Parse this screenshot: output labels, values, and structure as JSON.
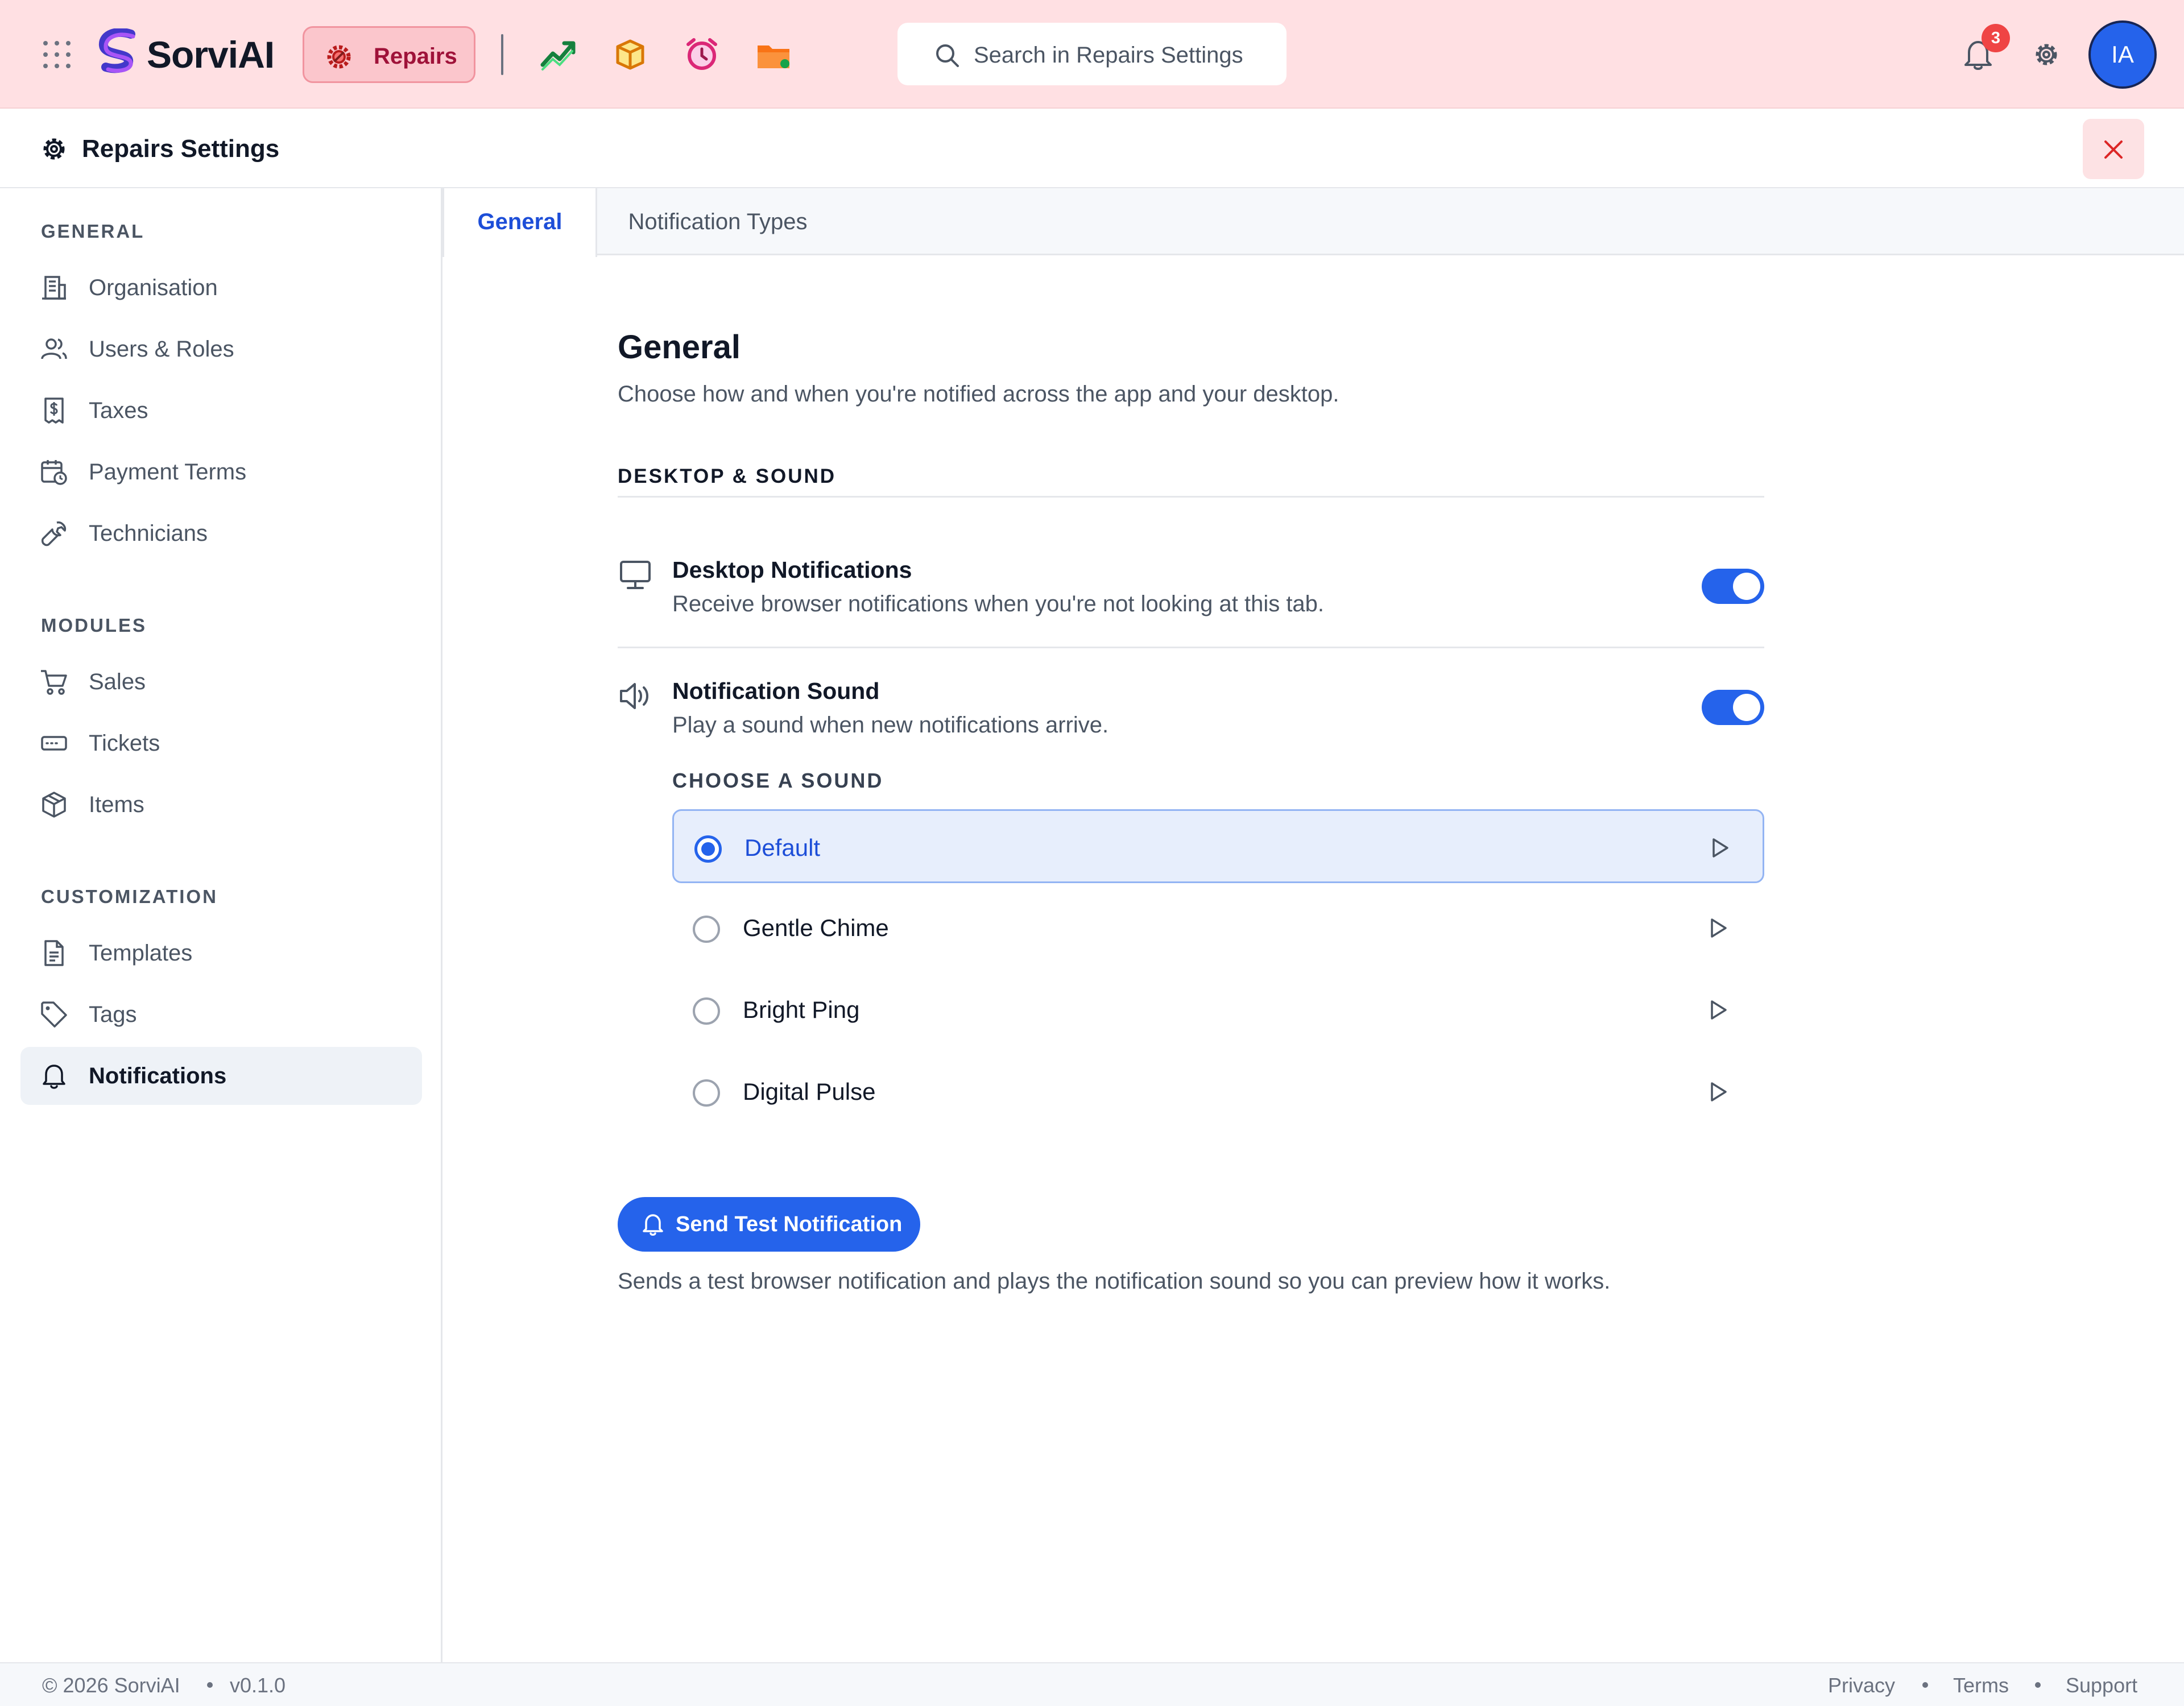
{
  "topbar": {
    "brand": "SorviAI",
    "module_label": "Repairs",
    "search_placeholder": "Search in Repairs Settings",
    "notification_count": "3",
    "avatar_initials": "IA",
    "app_icons": [
      "growth-chart-icon",
      "box-icon",
      "alarm-clock-icon",
      "folder-icon"
    ]
  },
  "settings": {
    "title": "Repairs Settings"
  },
  "sidebar": {
    "sections": [
      {
        "title": "GENERAL",
        "items": [
          {
            "label": "Organisation",
            "icon": "building-icon"
          },
          {
            "label": "Users & Roles",
            "icon": "users-icon"
          },
          {
            "label": "Taxes",
            "icon": "tax-icon"
          },
          {
            "label": "Payment Terms",
            "icon": "calendar-clock-icon"
          },
          {
            "label": "Technicians",
            "icon": "wrench-icon"
          }
        ]
      },
      {
        "title": "MODULES",
        "items": [
          {
            "label": "Sales",
            "icon": "cart-icon"
          },
          {
            "label": "Tickets",
            "icon": "ticket-icon"
          },
          {
            "label": "Items",
            "icon": "package-icon"
          }
        ]
      },
      {
        "title": "CUSTOMIZATION",
        "items": [
          {
            "label": "Templates",
            "icon": "document-icon"
          },
          {
            "label": "Tags",
            "icon": "tag-icon"
          },
          {
            "label": "Notifications",
            "icon": "bell-icon",
            "active": true
          }
        ]
      }
    ]
  },
  "tabs": [
    {
      "label": "General",
      "active": true
    },
    {
      "label": "Notification Types",
      "active": false
    }
  ],
  "main": {
    "title": "General",
    "subtitle": "Choose how and when you're notified across the app and your desktop.",
    "section_title": "DESKTOP & SOUND",
    "desktop": {
      "title": "Desktop Notifications",
      "description": "Receive browser notifications when you're not looking at this tab.",
      "enabled": true
    },
    "sound": {
      "title": "Notification Sound",
      "description": "Play a sound when new notifications arrive.",
      "enabled": true,
      "choose_label": "CHOOSE A SOUND",
      "options": [
        {
          "label": "Default",
          "selected": true
        },
        {
          "label": "Gentle Chime",
          "selected": false
        },
        {
          "label": "Bright Ping",
          "selected": false
        },
        {
          "label": "Digital Pulse",
          "selected": false
        }
      ]
    },
    "send_button": "Send Test Notification",
    "send_note": "Sends a test browser notification and plays the notification sound so you can preview how it works."
  },
  "footer": {
    "copyright": "© 2026 SorviAI",
    "version": "v0.1.0",
    "links": [
      "Privacy",
      "Terms",
      "Support"
    ]
  },
  "colors": {
    "topbar_bg": "#ffe0e3",
    "accent": "#2563eb",
    "module_pill": "#fbc6cc",
    "badge": "#ef4444"
  }
}
